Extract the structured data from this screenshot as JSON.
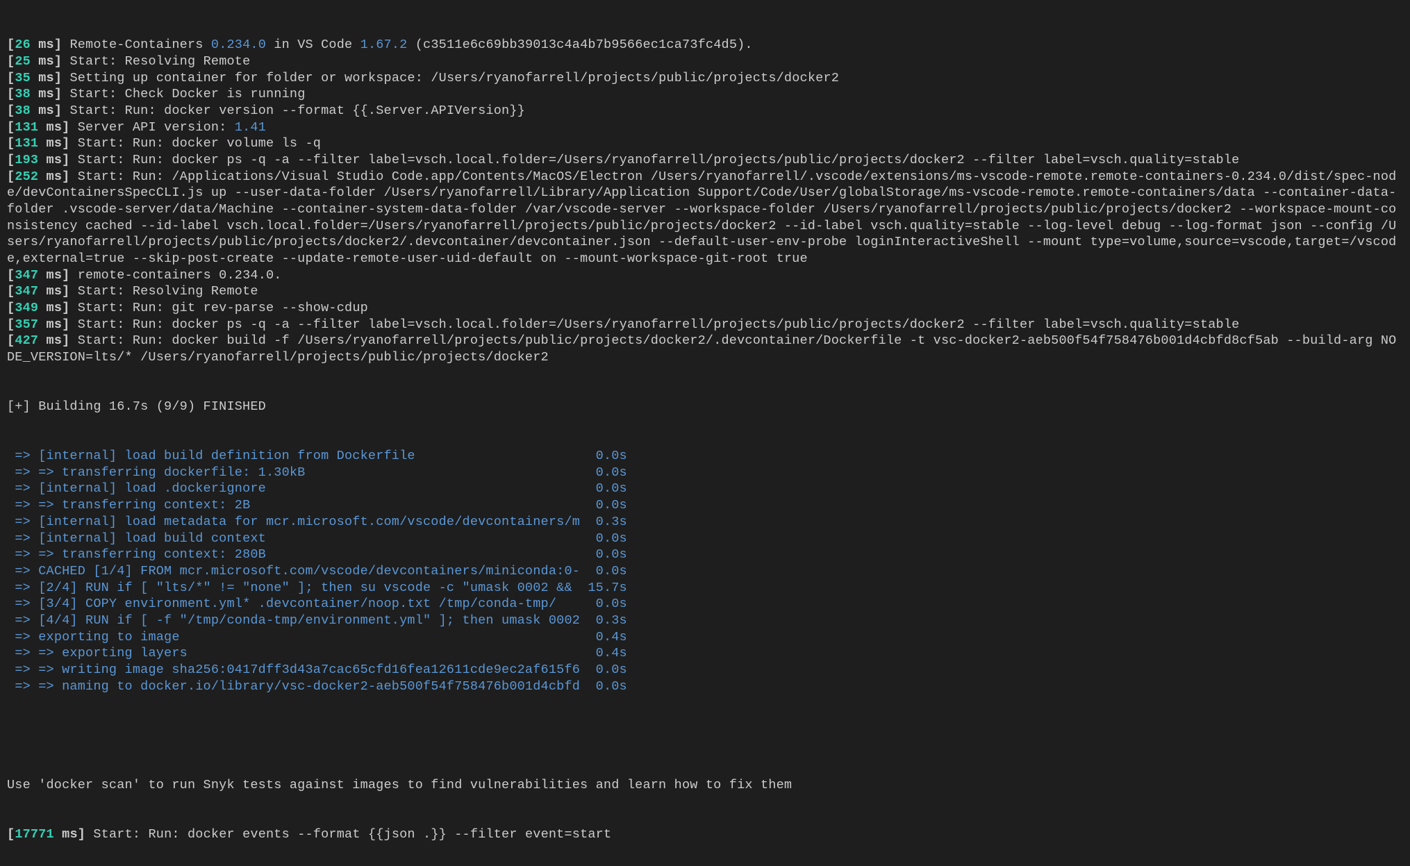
{
  "lines": [
    {
      "ts": "26",
      "segments": [
        {
          "t": " Remote-Containers "
        },
        {
          "t": "0.234.0",
          "cls": "blue-num"
        },
        {
          "t": " in VS Code "
        },
        {
          "t": "1.67.2",
          "cls": "blue-num"
        },
        {
          "t": " (c3511e6c69bb39013c4a4b7b9566ec1ca73fc4d5)."
        }
      ]
    },
    {
      "ts": "25",
      "segments": [
        {
          "t": " Start: Resolving Remote"
        }
      ]
    },
    {
      "ts": "35",
      "segments": [
        {
          "t": " Setting up container for folder or workspace: /Users/ryanofarrell/projects/public/projects/docker2"
        }
      ]
    },
    {
      "ts": "38",
      "segments": [
        {
          "t": " Start: Check Docker is running"
        }
      ]
    },
    {
      "ts": "38",
      "segments": [
        {
          "t": " Start: Run: docker version --format {{.Server.APIVersion}}"
        }
      ]
    },
    {
      "ts": "131",
      "segments": [
        {
          "t": " Server API version: "
        },
        {
          "t": "1.41",
          "cls": "blue-num"
        }
      ]
    },
    {
      "ts": "131",
      "segments": [
        {
          "t": " Start: Run: docker volume ls -q"
        }
      ]
    },
    {
      "ts": "193",
      "segments": [
        {
          "t": " Start: Run: docker ps -q -a --filter label=vsch.local.folder=/Users/ryanofarrell/projects/public/projects/docker2 --filter label=vsch.quality=stable"
        }
      ]
    },
    {
      "ts": "252",
      "segments": [
        {
          "t": " Start: Run: /Applications/Visual Studio Code.app/Contents/MacOS/Electron /Users/ryanofarrell/.vscode/extensions/ms-vscode-remote.remote-containers-0.234.0/dist/spec-node/devContainersSpecCLI.js up --user-data-folder /Users/ryanofarrell/Library/Application Support/Code/User/globalStorage/ms-vscode-remote.remote-containers/data --container-data-folder .vscode-server/data/Machine --container-system-data-folder /var/vscode-server --workspace-folder /Users/ryanofarrell/projects/public/projects/docker2 --workspace-mount-consistency cached --id-label vsch.local.folder=/Users/ryanofarrell/projects/public/projects/docker2 --id-label vsch.quality=stable --log-level debug --log-format json --config /Users/ryanofarrell/projects/public/projects/docker2/.devcontainer/devcontainer.json --default-user-env-probe loginInteractiveShell --mount type=volume,source=vscode,target=/vscode,external=true --skip-post-create --update-remote-user-uid-default on --mount-workspace-git-root true"
        }
      ]
    },
    {
      "ts": "347",
      "segments": [
        {
          "t": " remote-containers 0.234.0."
        }
      ]
    },
    {
      "ts": "347",
      "segments": [
        {
          "t": " Start: Resolving Remote"
        }
      ]
    },
    {
      "ts": "349",
      "segments": [
        {
          "t": " Start: Run: git rev-parse --show-cdup"
        }
      ]
    },
    {
      "ts": "357",
      "segments": [
        {
          "t": " Start: Run: docker ps -q -a --filter label=vsch.local.folder=/Users/ryanofarrell/projects/public/projects/docker2 --filter label=vsch.quality=stable"
        }
      ]
    },
    {
      "ts": "427",
      "segments": [
        {
          "t": " Start: Run: docker build -f /Users/ryanofarrell/projects/public/projects/docker2/.devcontainer/Dockerfile -t vsc-docker2-aeb500f54f758476b001d4cbfd8cf5ab --build-arg NODE_VERSION=lts/* /Users/ryanofarrell/projects/public/projects/docker2"
        }
      ]
    }
  ],
  "build_header": "[+] Building 16.7s (9/9) FINISHED",
  "build_steps": [
    {
      "left": " => [internal] load build definition from Dockerfile",
      "right": "0.0s"
    },
    {
      "left": " => => transferring dockerfile: 1.30kB",
      "right": "0.0s"
    },
    {
      "left": " => [internal] load .dockerignore",
      "right": "0.0s"
    },
    {
      "left": " => => transferring context: 2B",
      "right": "0.0s"
    },
    {
      "left": " => [internal] load metadata for mcr.microsoft.com/vscode/devcontainers/m",
      "right": "0.3s"
    },
    {
      "left": " => [internal] load build context",
      "right": "0.0s"
    },
    {
      "left": " => => transferring context: 280B",
      "right": "0.0s"
    },
    {
      "left": " => CACHED [1/4] FROM mcr.microsoft.com/vscode/devcontainers/miniconda:0-",
      "right": "0.0s"
    },
    {
      "left": " => [2/4] RUN if [ \"lts/*\" != \"none\" ]; then su vscode -c \"umask 0002 &&",
      "right": "15.7s"
    },
    {
      "left": " => [3/4] COPY environment.yml* .devcontainer/noop.txt /tmp/conda-tmp/",
      "right": "0.0s"
    },
    {
      "left": " => [4/4] RUN if [ -f \"/tmp/conda-tmp/environment.yml\" ]; then umask 0002",
      "right": "0.3s"
    },
    {
      "left": " => exporting to image",
      "right": "0.4s"
    },
    {
      "left": " => => exporting layers",
      "right": "0.4s"
    },
    {
      "left": " => => writing image sha256:0417dff3d43a7cac65cfd16fea12611cde9ec2af615f6",
      "right": "0.0s"
    },
    {
      "left": " => => naming to docker.io/library/vsc-docker2-aeb500f54f758476b001d4cbfd",
      "right": "0.0s"
    }
  ],
  "footer_plain": "Use 'docker scan' to run Snyk tests against images to find vulnerabilities and learn how to fix them",
  "footer_line": {
    "ts": "17771",
    "segments": [
      {
        "t": " Start: Run: docker events --format {{json .}} --filter event=start"
      }
    ]
  },
  "colors": {
    "teal": "#36d0b4",
    "blue": "#5a97d6",
    "fg": "#cccccc",
    "bg": "#1e1e1e"
  }
}
